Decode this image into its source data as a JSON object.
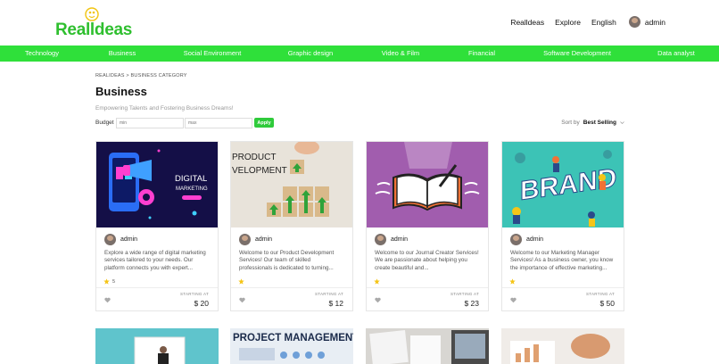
{
  "brand": {
    "name": "Realldeas",
    "color": "#2fbf2f"
  },
  "topnav": {
    "items": [
      "Realldeas",
      "Explore",
      "English"
    ],
    "user": "admin"
  },
  "categories": [
    "Technology",
    "Business",
    "Social Environment",
    "Graphic design",
    "Video & Film",
    "Financial",
    "Software Development",
    "Data analyst"
  ],
  "breadcrumb": "REALIDEAS > BUSINESS CATEGORY",
  "page": {
    "title": "Business",
    "subtitle": "Empowering Talents and Fostering Business Dreams!"
  },
  "filters": {
    "budget_label": "Budget",
    "min_placeholder": "min",
    "max_placeholder": "max",
    "apply_label": "Apply",
    "sort_label": "Sort by",
    "sort_value": "Best Selling"
  },
  "cards": [
    {
      "seller": "admin",
      "image_text": [
        "DIGITAL",
        "MARKETING"
      ],
      "description": "Explore a wide range of digital marketing services tailored to your needs. Our platform connects you with expert...",
      "rating_count": "5",
      "starting_label": "STARTING AT",
      "price": "$ 20"
    },
    {
      "seller": "admin",
      "image_text": [
        "PRODUCT",
        "VELOPMENT"
      ],
      "description": "Welcome to our Product Development Services! Our team of skilled professionals is dedicated to turning...",
      "rating_count": "",
      "starting_label": "STARTING AT",
      "price": "$ 12"
    },
    {
      "seller": "admin",
      "image_text": [],
      "description": "Welcome to our Journal Creator Services! We are passionate about helping you create beautiful and...",
      "rating_count": "",
      "starting_label": "STARTING AT",
      "price": "$ 23"
    },
    {
      "seller": "admin",
      "image_text": [
        "BRAND"
      ],
      "description": "Welcome to our Marketing Manager Services! As a business owner, you know the importance of effective marketing...",
      "rating_count": "",
      "starting_label": "STARTING AT",
      "price": "$ 50"
    }
  ],
  "row2": {
    "project_banner": "PROJECT MANAGEMENT"
  },
  "colors": {
    "accent_green": "#2fe03a",
    "apply_green": "#2fcb3b",
    "star": "#f5c518"
  }
}
